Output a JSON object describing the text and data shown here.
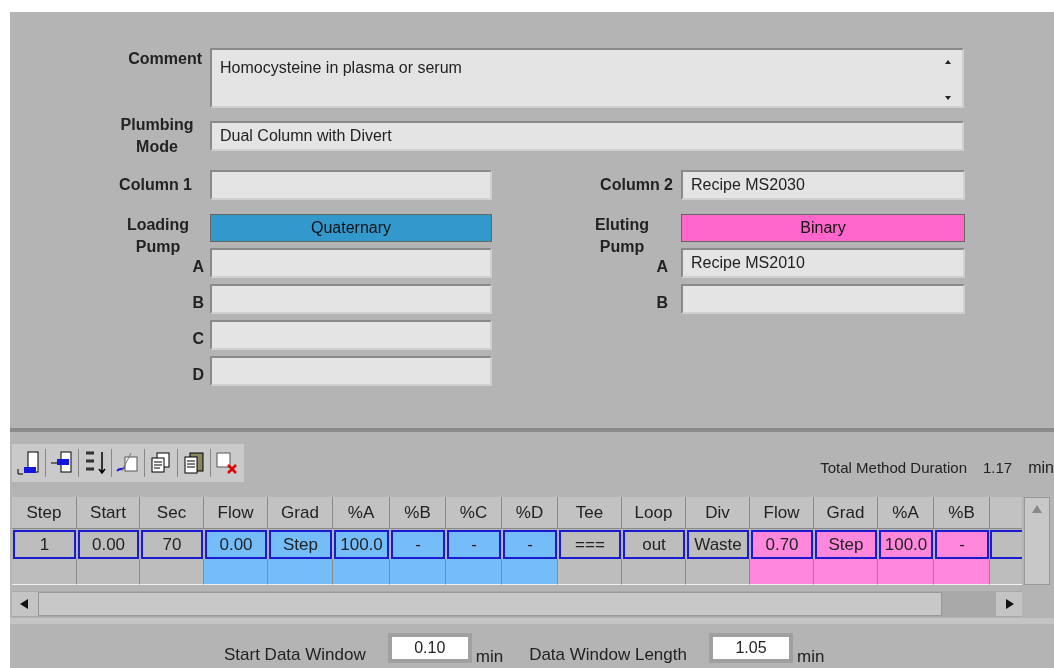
{
  "comment": {
    "label": "Comment",
    "value": "Homocysteine in plasma or serum"
  },
  "plumbing_mode": {
    "label": "Plumbing Mode",
    "value": "Dual Column with Divert"
  },
  "columns": [
    {
      "label": "Column 1"
    },
    {
      "label": "Column 2",
      "value": "Recipe MS2030"
    }
  ],
  "pumps": [
    {
      "label": "Loading Pump",
      "type": "Quaternary",
      "color": "#3399cc",
      "channels": [
        {
          "label": "A"
        },
        {
          "label": "B"
        },
        {
          "label": "C"
        },
        {
          "label": "D"
        }
      ]
    },
    {
      "label": "Eluting Pump",
      "type": "Binary",
      "color": "#ff66cc",
      "channels": [
        {
          "label": "A",
          "value": "Recipe MS2010"
        },
        {
          "label": "B"
        }
      ]
    }
  ],
  "total_duration": {
    "label": "Total Method Duration",
    "value": "1.17",
    "unit": "min"
  },
  "table": {
    "columns": [
      {
        "label": "Step"
      },
      {
        "label": "Start"
      },
      {
        "label": "Sec"
      },
      {
        "label": "Flow",
        "color": "#74bdf9"
      },
      {
        "label": "Grad",
        "color": "#74bdf9"
      },
      {
        "label": "%A",
        "color": "#74bdf9"
      },
      {
        "label": "%B",
        "color": "#74bdf9"
      },
      {
        "label": "%C",
        "color": "#74bdf9"
      },
      {
        "label": "%D",
        "color": "#74bdf9"
      },
      {
        "label": "Tee"
      },
      {
        "label": "Loop"
      },
      {
        "label": "Div"
      },
      {
        "label": "Flow",
        "color": "#ff88dd"
      },
      {
        "label": "Grad",
        "color": "#ff88dd"
      },
      {
        "label": "%A",
        "color": "#ff88dd"
      },
      {
        "label": "%B",
        "color": "#ff88dd"
      }
    ],
    "rows": [
      {
        "selected": true,
        "cells": [
          "1",
          "0.00",
          "70",
          "0.00",
          "Step",
          "100.0",
          "-",
          "-",
          "-",
          "===",
          "out",
          "Waste",
          "0.70",
          "Step",
          "100.0",
          "-"
        ]
      }
    ]
  },
  "data_window": [
    {
      "label": "Start Data Window",
      "value": "0.10",
      "unit": "min"
    },
    {
      "label": "Data Window Length",
      "value": "1.05",
      "unit": "min"
    }
  ]
}
